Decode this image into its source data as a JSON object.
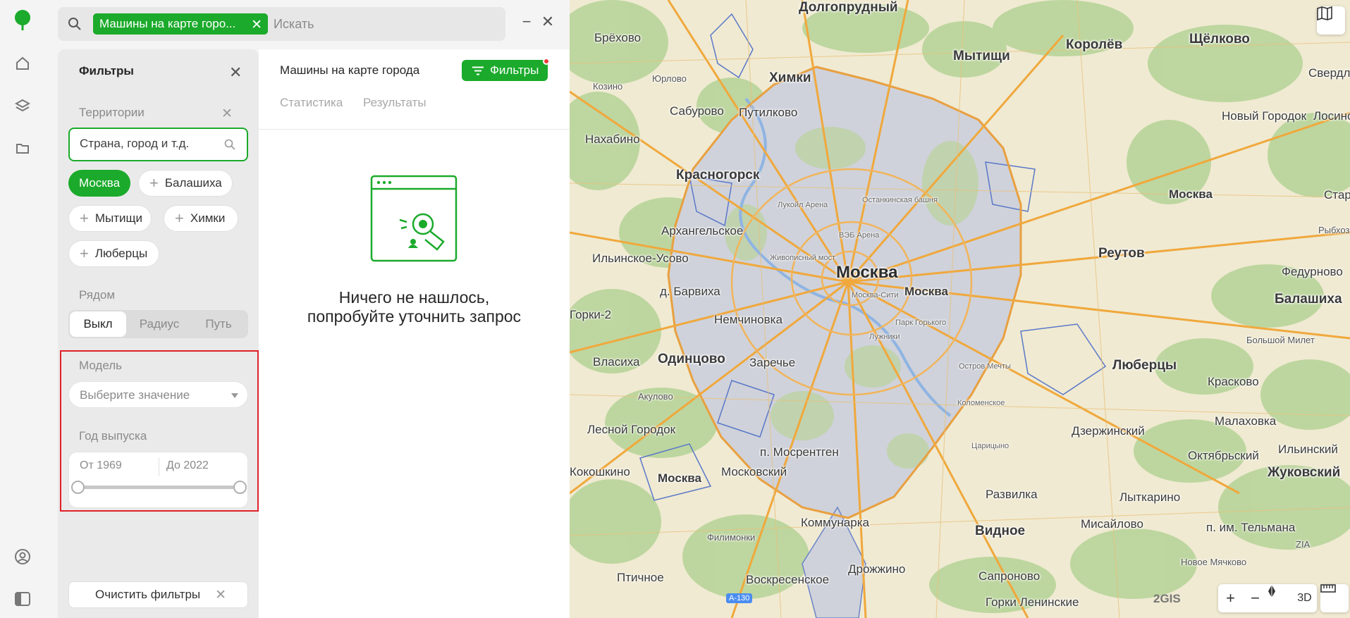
{
  "search": {
    "chip_label": "Машины на карте горо...",
    "placeholder": "Искать"
  },
  "filters": {
    "title": "Фильтры",
    "territories_label": "Территории",
    "territory_input_placeholder": "Страна, город и т.д.",
    "selected_city": "Москва",
    "suggested_cities": [
      "Балашиха",
      "Мытищи",
      "Химки",
      "Люберцы"
    ],
    "nearby_label": "Рядом",
    "nearby_options": [
      "Выкл",
      "Радиус",
      "Путь"
    ],
    "nearby_selected": "Выкл",
    "model_label": "Модель",
    "model_placeholder": "Выберите значение",
    "year_label": "Год выпуска",
    "year_from": "От 1969",
    "year_to": "До 2022",
    "clear_label": "Очистить фильтры"
  },
  "results": {
    "title": "Машины на карте города",
    "filter_button": "Фильтры",
    "tabs": [
      "Статистика",
      "Результаты"
    ],
    "empty_line1": "Ничего не нашлось,",
    "empty_line2": "попробуйте уточнить запрос"
  },
  "map": {
    "labels": {
      "moskva_center": "Москва",
      "moskva_small": "Москва",
      "moskva_east": "Москва",
      "moskva_sw": "Москва",
      "dolgoprudny": "Долгопрудный",
      "brekhovo": "Брёхово",
      "khimki": "Химки",
      "mytishchi": "Мытищи",
      "korolev": "Королёв",
      "shchelkovo": "Щёлково",
      "sverdlovsk": "Свердлово",
      "kozino": "Козино",
      "yurlovo": "Юрлово",
      "saburovo": "Сабурово",
      "putilkovo": "Путилково",
      "nakhabino": "Нахабино",
      "krasnogorsk": "Красногорск",
      "novy_gorodok": "Новый Городок",
      "losino": "Лосино",
      "staraya": "Старая",
      "arkhangelskoe": "Архангельское",
      "ilinskoe_usovo": "Ильинское-Усово",
      "reutov": "Реутов",
      "rybkhoz": "Рыбхоз",
      "barvikha": "д. Барвиха",
      "balashikha": "Балашиха",
      "fedurnovo": "Федурново",
      "gorki2": "Горки-2",
      "nemchinovka": "Немчиновка",
      "odintsovo": "Одинцово",
      "vlasikha": "Власиха",
      "zarechye": "Заречье",
      "lyubertsy": "Люберцы",
      "kraskovo": "Красково",
      "bolshoi_milet": "Большой Милет",
      "akulovo": "Акулово",
      "lesnoy_gorodok": "Лесной Городок",
      "dzerzhinsky": "Дзержинский",
      "malakhovka": "Малаховка",
      "kokoshkino": "Кокошкино",
      "mosrentgen": "п. Мосрентген",
      "moskovsky": "Московский",
      "oktyabrsky": "Октябрьский",
      "ilinsky": "Ильинский",
      "zhukovsky": "Жуковский",
      "razvilka": "Развилка",
      "lytkarino": "Лыткарино",
      "kommunarka": "Коммунарка",
      "vidnoe": "Видное",
      "misailovo": "Мисайлово",
      "telmana": "п. им. Тельмана",
      "filimonki": "Филимонки",
      "zia": "ZIA",
      "ptichnoe": "Птичное",
      "drozhzhino": "Дрожжино",
      "novoe_myachkovo": "Новое Мячково",
      "voskresenskoe": "Воскресенское",
      "saprono": "Сапроново",
      "gorki_leninskie": "Горки Ленинские",
      "a130": "А-130",
      "ostankino": "Останкинская башня",
      "luzhniki_arena": "Лукойл Арена",
      "veb_arena": "ВЭБ Арена",
      "zhivopisny": "Живописный мост",
      "moscow_city": "Москва-Сити",
      "park_gorkogo": "Парк Горького",
      "luzhniki": "Лужники",
      "ostrov_mechty": "Остров Мечты",
      "kolomenskoe": "Коломенское",
      "tsaritsyno": "Царицыно"
    },
    "controls": {
      "zoom_in": "+",
      "zoom_out": "−",
      "mode_3d": "3D"
    },
    "brand": "2GIS"
  },
  "colors": {
    "accent": "#1baa2b",
    "highlight": "#e0202a",
    "moscow_fill": "#c9ccd6",
    "forest": "#b9d39a",
    "road": "#f0a83c"
  }
}
